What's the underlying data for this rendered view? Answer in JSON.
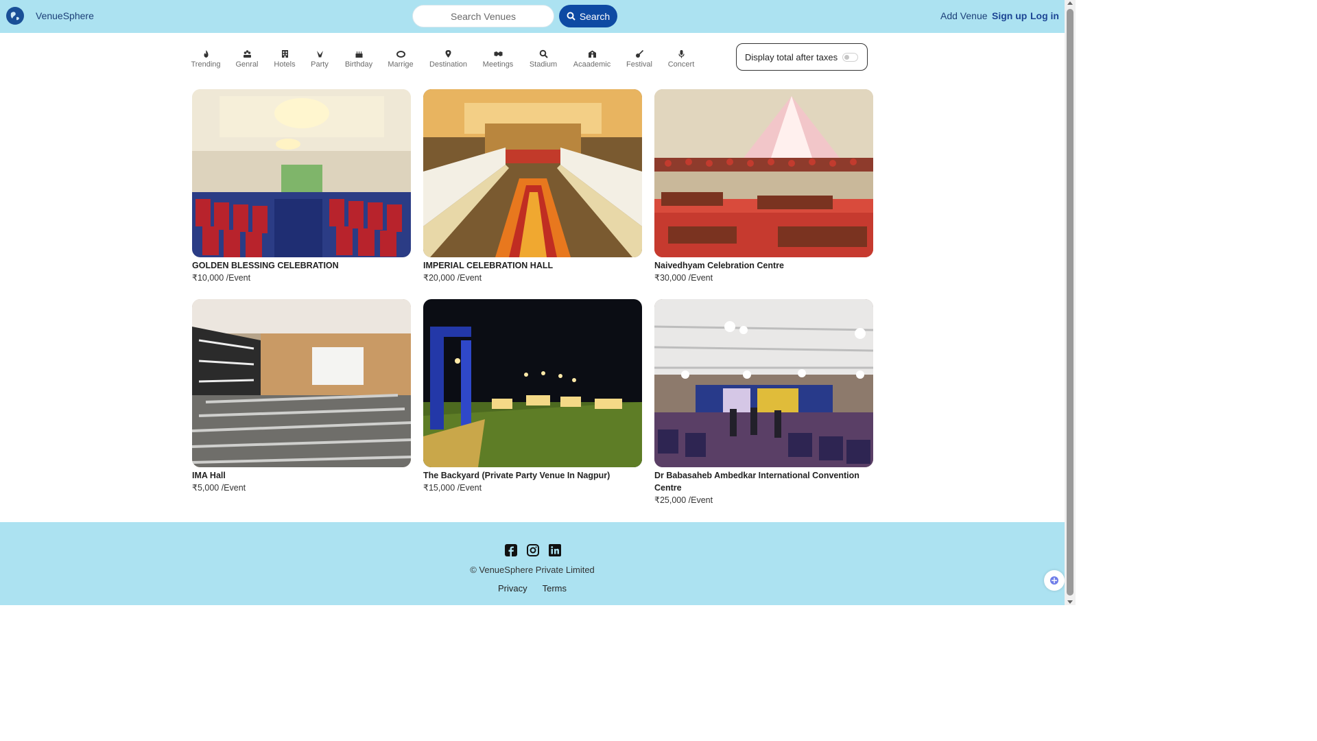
{
  "navbar": {
    "brand": "VenueSphere",
    "search_placeholder": "Search Venues",
    "search_button": "Search",
    "add_venue": "Add Venue",
    "sign_up": "Sign up",
    "log_in": "Log in"
  },
  "filters": [
    {
      "label": "Trending",
      "icon": "fire-icon"
    },
    {
      "label": "Genral",
      "icon": "people-icon"
    },
    {
      "label": "Hotels",
      "icon": "hotel-icon"
    },
    {
      "label": "Party",
      "icon": "party-icon"
    },
    {
      "label": "Birthday",
      "icon": "cake-icon"
    },
    {
      "label": "Marrige",
      "icon": "ring-icon"
    },
    {
      "label": "Destination",
      "icon": "location-pin-icon"
    },
    {
      "label": "Meetings",
      "icon": "handshake-icon"
    },
    {
      "label": "Stadium",
      "icon": "search-icon"
    },
    {
      "label": "Acaademic",
      "icon": "school-icon"
    },
    {
      "label": "Festival",
      "icon": "guitar-icon"
    },
    {
      "label": "Concert",
      "icon": "microphone-icon"
    }
  ],
  "tax_toggle": {
    "label": "Display total after taxes",
    "enabled": false
  },
  "listings": [
    {
      "title": "GOLDEN BLESSING CELEBRATION",
      "price": "₹10,000 /Event",
      "image": "banquet-hall-photo"
    },
    {
      "title": "IMPERIAL CELEBRATION HALL",
      "price": "₹20,000 /Event",
      "image": "dining-hall-photo"
    },
    {
      "title": "Naivedhyam Celebration Centre",
      "price": "₹30,000 /Event",
      "image": "wedding-mandap-photo"
    },
    {
      "title": "IMA Hall",
      "price": "₹5,000 /Event",
      "image": "auditorium-photo"
    },
    {
      "title": "The Backyard (Private Party Venue In Nagpur)",
      "price": "₹15,000 /Event",
      "image": "garden-venue-photo"
    },
    {
      "title": "Dr Babasaheb Ambedkar International Convention Centre",
      "price": "₹25,000 /Event",
      "image": "convention-hall-photo"
    }
  ],
  "footer": {
    "socials": [
      "facebook-icon",
      "instagram-icon",
      "linkedin-icon"
    ],
    "copyright": "© VenueSphere Private Limited",
    "privacy": "Privacy",
    "terms": "Terms"
  },
  "colors": {
    "navbar_bg": "#ace2f1",
    "primary": "#0e4aa3",
    "link": "#1c4594"
  }
}
